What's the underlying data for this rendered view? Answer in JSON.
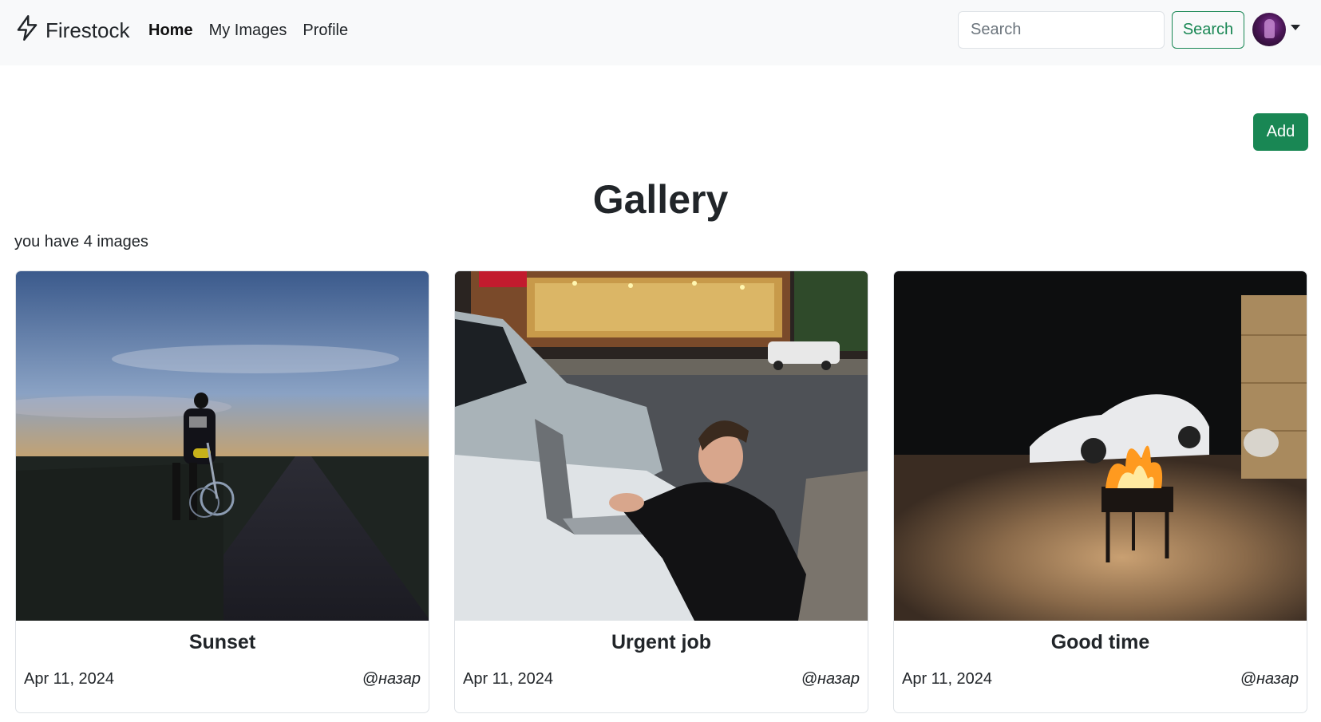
{
  "brand": {
    "name": "Firestock",
    "icon": "lightning-icon"
  },
  "nav": {
    "links": [
      {
        "label": "Home",
        "active": true
      },
      {
        "label": "My Images",
        "active": false
      },
      {
        "label": "Profile",
        "active": false
      }
    ]
  },
  "search": {
    "placeholder": "Search",
    "value": "",
    "button_label": "Search"
  },
  "user_menu": {
    "icon": "avatar"
  },
  "toolbar": {
    "add_label": "Add"
  },
  "main": {
    "title": "Gallery",
    "count_text": "you have 4 images"
  },
  "cards": [
    {
      "title": "Sunset",
      "date": "Apr 11, 2024",
      "author": "@назар"
    },
    {
      "title": "Urgent job",
      "date": "Apr 11, 2024",
      "author": "@назар"
    },
    {
      "title": "Good time",
      "date": "Apr 11, 2024",
      "author": "@назар"
    }
  ],
  "colors": {
    "accent": "#198754",
    "navbar_bg": "#f8f9fa",
    "text": "#212529"
  }
}
